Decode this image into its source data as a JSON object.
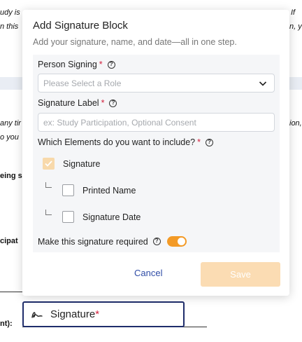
{
  "background": {
    "line1_left": "udy is",
    "line1_right": "If",
    "line2_left": "n this",
    "line2_right": "n, you",
    "line3_left": "any tir",
    "line3_right": "ion,",
    "line4_left": "o you",
    "heading1": "eing s",
    "heading2": "cipat",
    "field_label": "nt):",
    "signature_field": {
      "label": "Signature",
      "required_mark": "*"
    }
  },
  "modal": {
    "title": "Add Signature Block",
    "subtitle": "Add your signature, name, and date—all in one step.",
    "person_signing": {
      "label": "Person Signing",
      "required_mark": "*",
      "placeholder": "Please Select a Role"
    },
    "signature_label": {
      "label": "Signature Label",
      "required_mark": "*",
      "placeholder": "ex: Study Participation, Optional Consent"
    },
    "elements": {
      "label": "Which Elements do you want to include?",
      "required_mark": "*",
      "options": [
        {
          "label": "Signature",
          "checked": true
        },
        {
          "label": "Printed Name",
          "checked": false
        },
        {
          "label": "Signature Date",
          "checked": false
        }
      ]
    },
    "required_toggle": {
      "label": "Make this signature required",
      "on": true
    },
    "cancel_label": "Cancel",
    "save_label": "Save"
  },
  "colors": {
    "accent": "#f39a26",
    "save_disabled": "#fbdcb3",
    "link": "#2f4ca6",
    "required": "#d21f3c"
  }
}
